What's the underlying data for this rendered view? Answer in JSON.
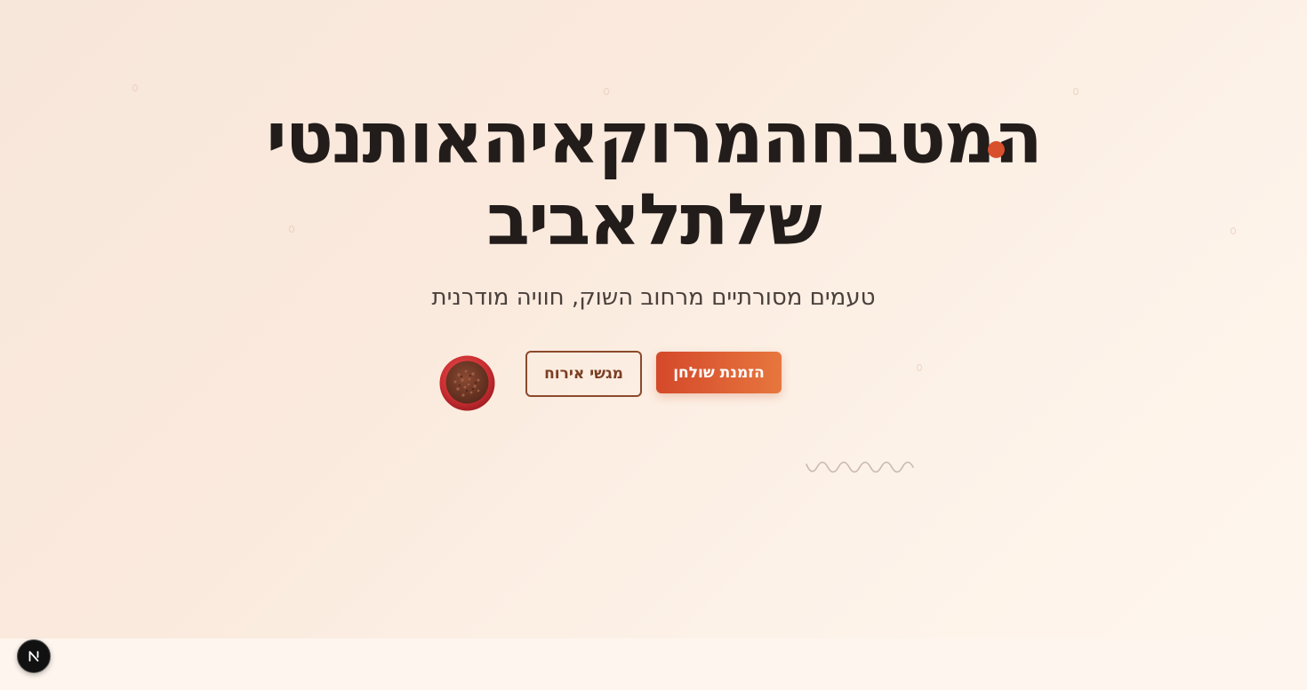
{
  "hero": {
    "headline_line1": "המטבחהמרוקאיהאותנטי",
    "headline_line2": "שלתלאביב",
    "subtitle": "טעמים מסורתיים מרחוב השוק, חוויה מודרנית",
    "primary_button_label": "הזמנת שולחן",
    "secondary_button_label": "מגשי אירוח",
    "decorations": {
      "spice_bowl_icon": "spice-bowl",
      "squiggle_icon": "wave-line"
    }
  },
  "devtools": {
    "badge_letter": "N",
    "badge_icon": "nextjs-icon"
  },
  "colors": {
    "accent": "#d8502c",
    "primary_button_gradient": [
      "#d4492a",
      "#e7763e"
    ],
    "secondary_button_border": "#8a4a2c",
    "headline": "#221c1a",
    "background": "#f9e9dd"
  }
}
